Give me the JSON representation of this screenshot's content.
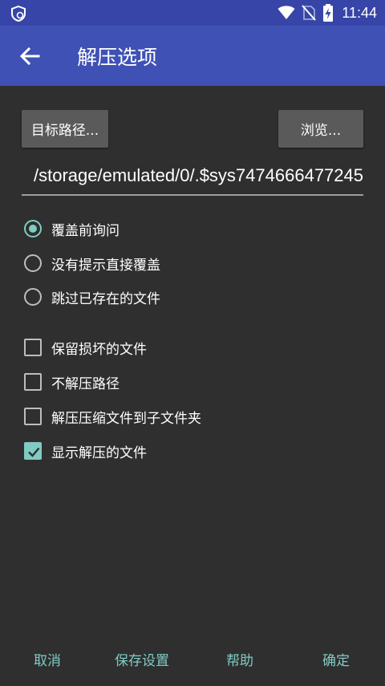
{
  "status_bar": {
    "time": "11:44",
    "icons": [
      "shield-icon",
      "wifi-icon",
      "no-sim-icon",
      "battery-charging-icon"
    ]
  },
  "app_bar": {
    "title": "解压选项",
    "back_icon": "arrow-back-icon"
  },
  "destination": {
    "target_button": "目标路径...",
    "browse_button": "浏览...",
    "path_value": "/storage/emulated/0/.$sys7474666477245"
  },
  "overwrite_options": [
    {
      "label": "覆盖前询问",
      "checked": true
    },
    {
      "label": "没有提示直接覆盖",
      "checked": false
    },
    {
      "label": "跳过已存在的文件",
      "checked": false
    }
  ],
  "checkbox_options": [
    {
      "label": "保留损坏的文件",
      "checked": false
    },
    {
      "label": "不解压路径",
      "checked": false
    },
    {
      "label": "解压压缩文件到子文件夹",
      "checked": false
    },
    {
      "label": "显示解压的文件",
      "checked": true
    }
  ],
  "footer": {
    "cancel": "取消",
    "save_settings": "保存设置",
    "help": "帮助",
    "ok": "确定"
  },
  "colors": {
    "status_bar": "#3745a8",
    "app_bar": "#3f51b5",
    "background": "#2f2f2f",
    "accent": "#80cbc4",
    "button": "#5a5a5a"
  }
}
